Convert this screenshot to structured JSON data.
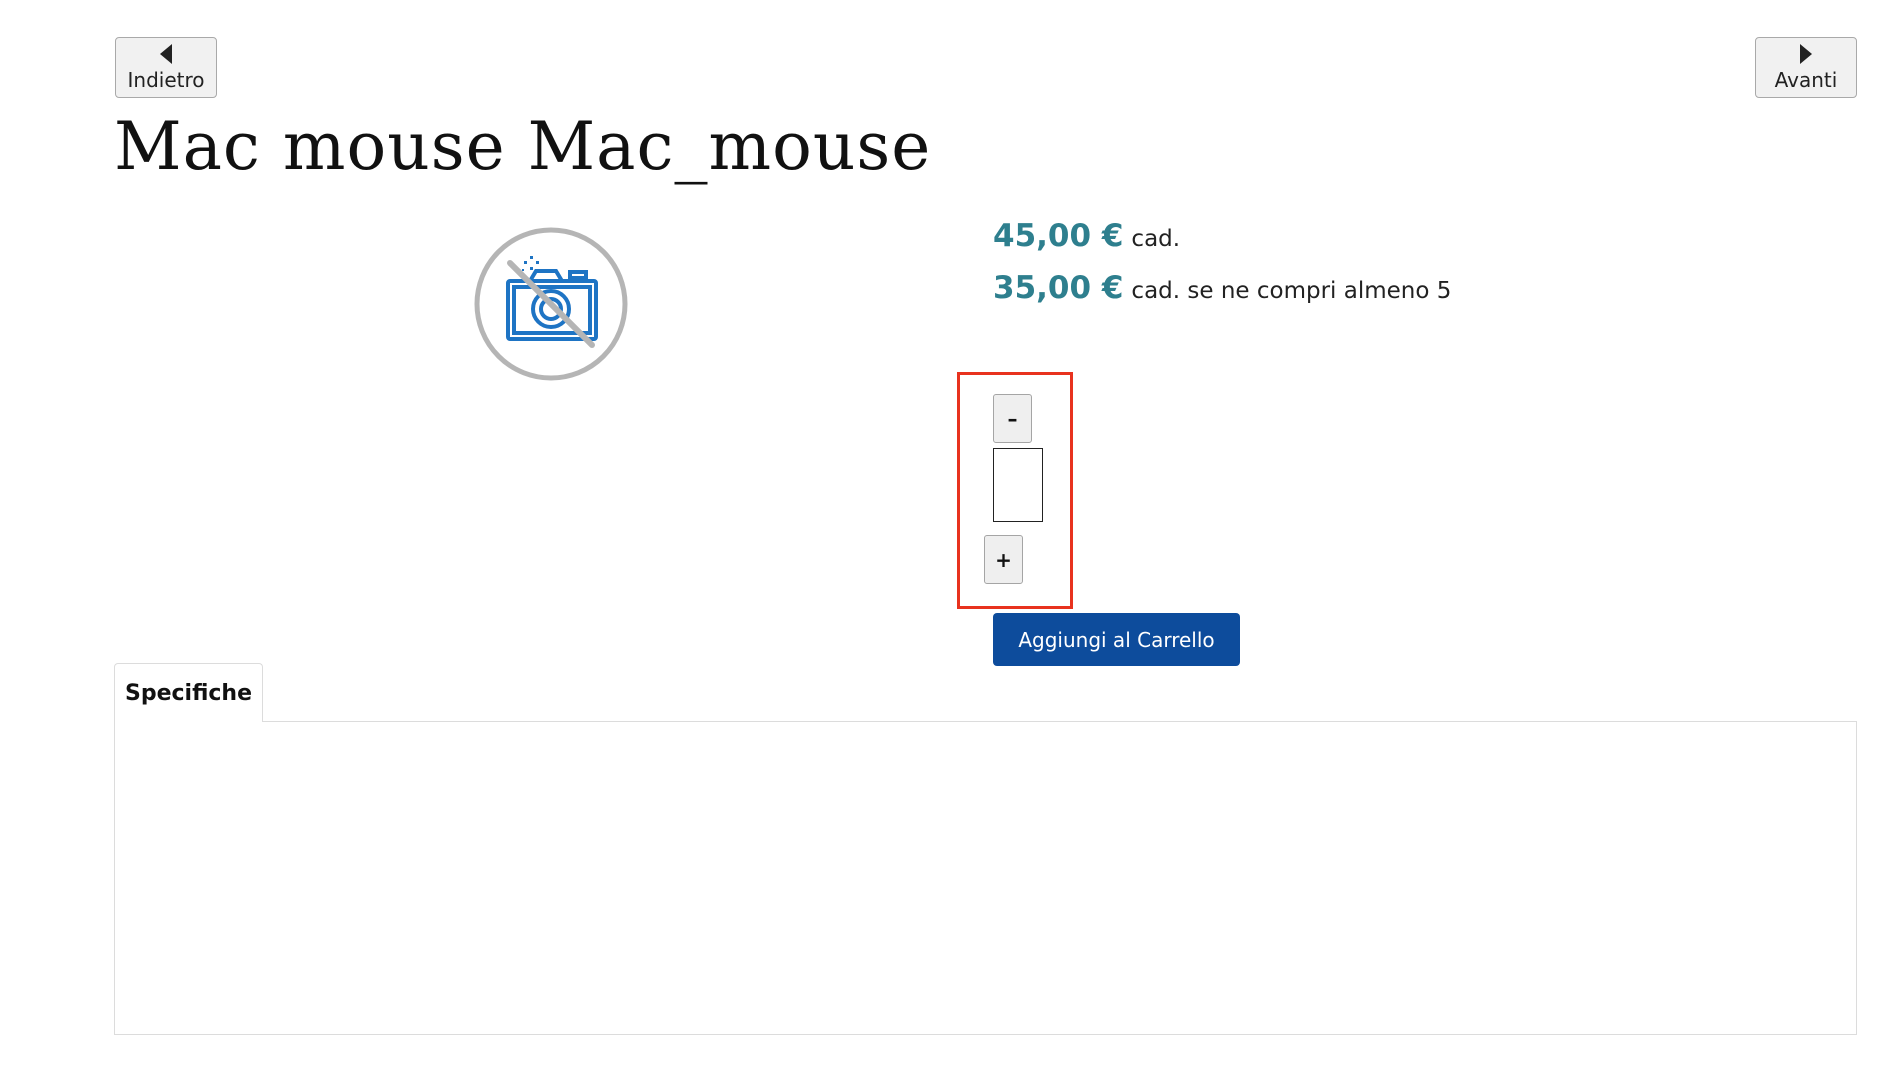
{
  "nav": {
    "prev_label": "Indietro",
    "next_label": "Avanti"
  },
  "product": {
    "title": "Mac mouse Mac_mouse",
    "image_icon": "no-photo-camera-icon"
  },
  "pricing": {
    "price1_amount": "45,00 €",
    "price1_suffix": "cad.",
    "price2_amount": "35,00 €",
    "price2_suffix": "cad. se ne compri almeno 5"
  },
  "quantity": {
    "minus_label": "–",
    "plus_label": "+",
    "value": ""
  },
  "cart": {
    "add_label": "Aggiungi al Carrello"
  },
  "tabs": [
    {
      "label": "Specifiche"
    }
  ],
  "colors": {
    "price": "#2e7f8e",
    "primary_button": "#0d4c9c",
    "highlight": "#e8321e",
    "icon_blue": "#1e74c4",
    "icon_gray": "#b5b5b5"
  }
}
